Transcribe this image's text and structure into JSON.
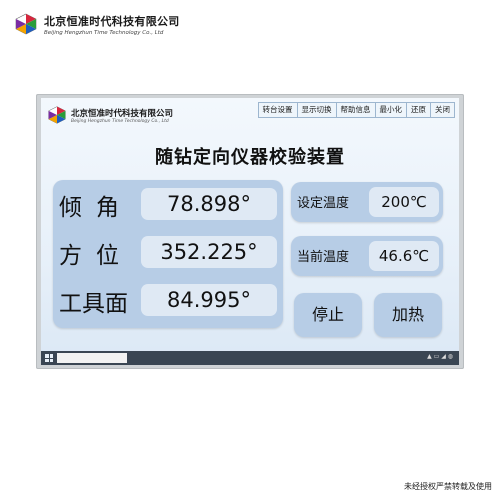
{
  "brand": {
    "cn": "北京恒准时代科技有限公司",
    "en": "Beijing Hengzhun Time Technology Co., Ltd"
  },
  "app": {
    "company_cn": "北京恒准时代科技有限公司",
    "company_en": "Beijing Hengzhun Time Technology Co., Ltd",
    "title": "随钻定向仪器校验装置",
    "menu": [
      "转台设置",
      "显示切换",
      "帮助信息",
      "最小化",
      "还原",
      "关闭"
    ]
  },
  "readings": [
    {
      "label": "倾角",
      "value": "78.898°"
    },
    {
      "label": "方位",
      "value": "352.225°"
    },
    {
      "label": "工具面",
      "value": "84.995°"
    }
  ],
  "temperature": {
    "set_label": "设定温度",
    "set_value": "200℃",
    "current_label": "当前温度",
    "current_value": "46.6℃"
  },
  "buttons": {
    "stop": "停止",
    "heat": "加热"
  },
  "footer": "未经授权严禁转载及使用"
}
